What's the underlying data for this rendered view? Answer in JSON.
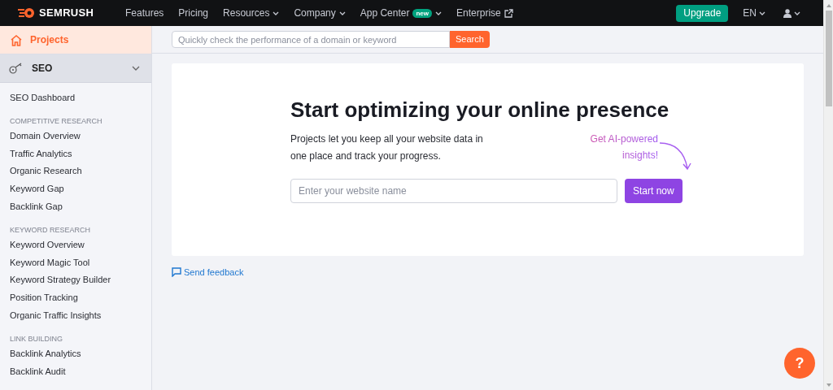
{
  "topbar": {
    "logo": "SEMRUSH",
    "nav": [
      {
        "label": "Features",
        "dropdown": false,
        "external": false
      },
      {
        "label": "Pricing",
        "dropdown": false,
        "external": false
      },
      {
        "label": "Resources",
        "dropdown": true,
        "external": false
      },
      {
        "label": "Company",
        "dropdown": true,
        "external": false
      },
      {
        "label": "App Center",
        "badge": "new",
        "dropdown": true,
        "external": false
      },
      {
        "label": "Enterprise",
        "dropdown": false,
        "external": true
      }
    ],
    "upgrade": "Upgrade",
    "language": "EN"
  },
  "sidebar": {
    "projects": {
      "label": "Projects",
      "selected": true
    },
    "section": {
      "label": "SEO",
      "expanded": true
    },
    "groups": [
      {
        "items": [
          "SEO Dashboard"
        ]
      },
      {
        "heading": "COMPETITIVE RESEARCH",
        "items": [
          "Domain Overview",
          "Traffic Analytics",
          "Organic Research",
          "Keyword Gap",
          "Backlink Gap"
        ]
      },
      {
        "heading": "KEYWORD RESEARCH",
        "items": [
          "Keyword Overview",
          "Keyword Magic Tool",
          "Keyword Strategy Builder",
          "Position Tracking",
          "Organic Traffic Insights"
        ]
      },
      {
        "heading": "LINK BUILDING",
        "items": [
          "Backlink Analytics",
          "Backlink Audit"
        ]
      }
    ]
  },
  "search": {
    "placeholder": "Quickly check the performance of a domain or keyword",
    "button": "Search"
  },
  "card": {
    "title": "Start optimizing your online presence",
    "text": "Projects let you keep all your website data in one place and track your progress.",
    "hint": "Get AI-powered insights!",
    "input_placeholder": "Enter your website name",
    "button": "Start now"
  },
  "feedback": "Send feedback",
  "help": "?"
}
